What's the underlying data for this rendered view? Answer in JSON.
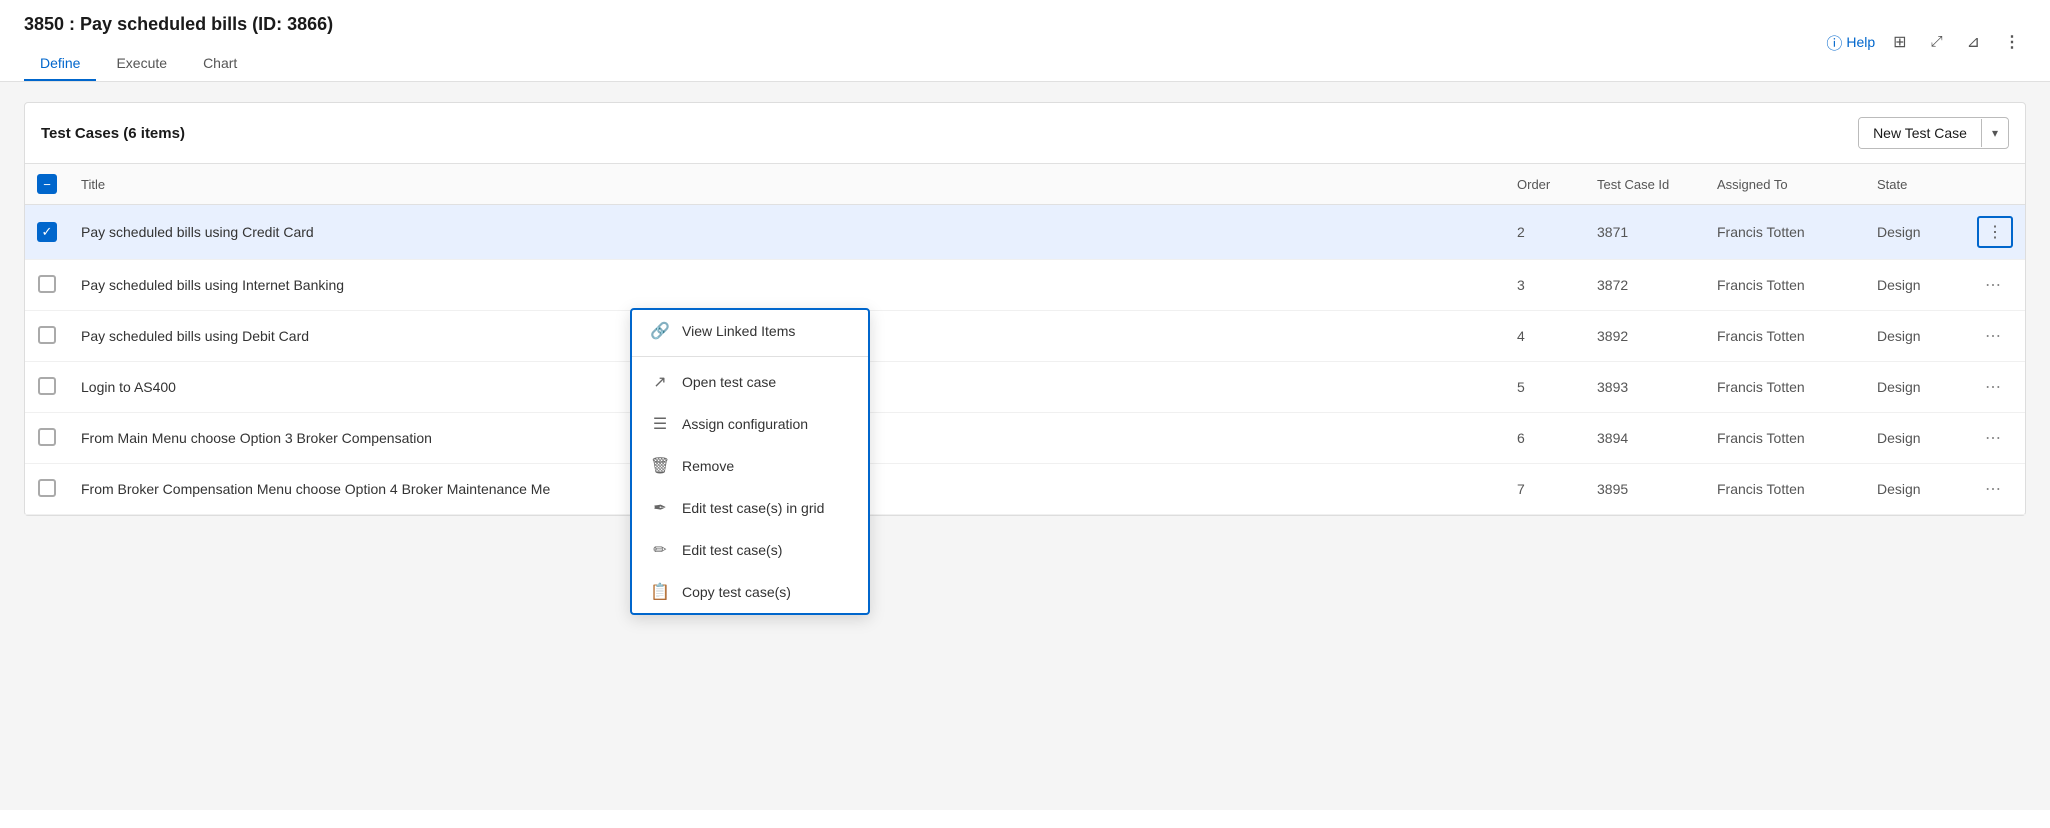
{
  "page": {
    "title": "3850 : Pay scheduled bills (ID: 3866)",
    "help_label": "Help"
  },
  "tabs": [
    {
      "id": "define",
      "label": "Define",
      "active": true
    },
    {
      "id": "execute",
      "label": "Execute",
      "active": false
    },
    {
      "id": "chart",
      "label": "Chart",
      "active": false
    }
  ],
  "toolbar": {
    "grid_icon": "⊞",
    "expand_icon": "↗",
    "filter_icon": "⊿",
    "more_icon": "⋮"
  },
  "panel": {
    "title": "Test Cases (6 items)",
    "new_test_case_label": "New Test Case",
    "dropdown_arrow": "⌄"
  },
  "table": {
    "columns": [
      {
        "id": "checkbox",
        "label": ""
      },
      {
        "id": "title",
        "label": "Title"
      },
      {
        "id": "order",
        "label": "Order"
      },
      {
        "id": "test_case_id",
        "label": "Test Case Id"
      },
      {
        "id": "assigned_to",
        "label": "Assigned To"
      },
      {
        "id": "state",
        "label": "State"
      },
      {
        "id": "action",
        "label": ""
      }
    ],
    "rows": [
      {
        "id": 1,
        "selected": true,
        "title": "Pay scheduled bills using Credit Card",
        "order": "2",
        "test_case_id": "3871",
        "assigned_to": "Francis Totten",
        "state": "Design",
        "show_action_menu": true
      },
      {
        "id": 2,
        "selected": false,
        "title": "Pay scheduled bills using Internet Banking",
        "order": "3",
        "test_case_id": "3872",
        "assigned_to": "Francis Totten",
        "state": "Design",
        "show_action_menu": false
      },
      {
        "id": 3,
        "selected": false,
        "title": "Pay scheduled bills using Debit Card",
        "order": "4",
        "test_case_id": "3892",
        "assigned_to": "Francis Totten",
        "state": "Design",
        "show_action_menu": false
      },
      {
        "id": 4,
        "selected": false,
        "title": "Login to AS400",
        "order": "5",
        "test_case_id": "3893",
        "assigned_to": "Francis Totten",
        "state": "Design",
        "show_action_menu": false
      },
      {
        "id": 5,
        "selected": false,
        "title": "From Main Menu choose Option 3 Broker Compensation",
        "order": "6",
        "test_case_id": "3894",
        "assigned_to": "Francis Totten",
        "state": "Design",
        "show_action_menu": false
      },
      {
        "id": 6,
        "selected": false,
        "title": "From Broker Compensation Menu choose Option 4 Broker Maintenance Me",
        "order": "7",
        "test_case_id": "3895",
        "assigned_to": "Francis Totten",
        "state": "Design",
        "show_action_menu": false
      }
    ]
  },
  "context_menu": {
    "items": [
      {
        "id": "view-linked",
        "icon": "🔗",
        "label": "View Linked Items",
        "divider_after": true
      },
      {
        "id": "open-test",
        "icon": "✏️",
        "label": "Open test case",
        "divider_after": false
      },
      {
        "id": "assign-config",
        "icon": "☰",
        "label": "Assign configuration",
        "divider_after": false
      },
      {
        "id": "remove",
        "icon": "🗑",
        "label": "Remove",
        "divider_after": false
      },
      {
        "id": "edit-grid",
        "icon": "✒️",
        "label": "Edit test case(s) in grid",
        "divider_after": false
      },
      {
        "id": "edit",
        "icon": "✏️",
        "label": "Edit test case(s)",
        "divider_after": false
      },
      {
        "id": "copy",
        "icon": "📋",
        "label": "Copy test case(s)",
        "divider_after": false
      }
    ]
  }
}
